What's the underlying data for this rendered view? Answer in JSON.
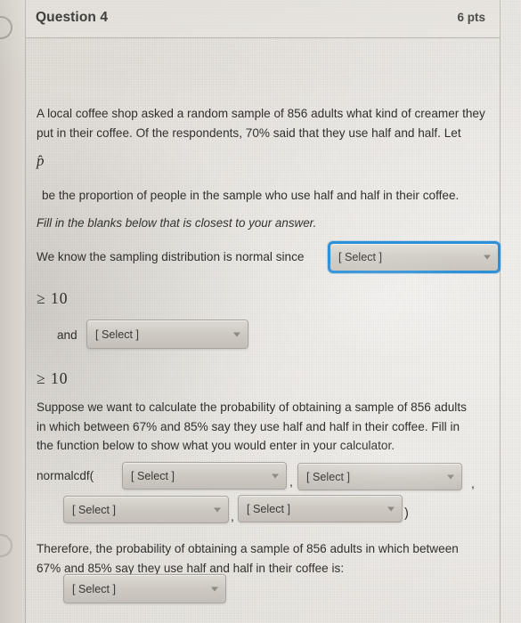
{
  "header": {
    "question_title": "Question 4",
    "points": "6 pts"
  },
  "body": {
    "paragraph_1": "A local coffee shop asked a random sample of 856 adults what kind of creamer they put in their coffee. Of the respondents, 70% said that they use half and half. Let",
    "phat_symbol": "p̂",
    "paragraph_2": "be the proportion of people in the sample who use half and half in their coffee.",
    "instruction_italic": "Fill in the blanks below that is closest to your answer.",
    "label_since": "We know the sampling distribution is normal since",
    "ge_ten_1": "≥ 10",
    "label_and": "and",
    "ge_ten_2": "≥ 10",
    "paragraph_3": "Suppose we want to calculate the probability of obtaining a sample of 856 adults in which between 67% and 85% say they use half and half in their coffee. Fill in the function below to show what you would enter in your calculator.",
    "label_normalcdf": "normalcdf(",
    "comma_1": ",",
    "comma_2": ",",
    "comma_3": ",",
    "paren_close": ")",
    "paragraph_4": "Therefore, the probability of obtaining a sample of 856 adults in which between 67% and 85% say they use half and half in their coffee is:"
  },
  "selects": {
    "condition": {
      "value": "[ Select ]",
      "focused": true
    },
    "and_condition": {
      "value": "[ Select ]",
      "focused": false
    },
    "normalcdf_arg_1": {
      "value": "[ Select ]",
      "focused": false
    },
    "normalcdf_arg_2": {
      "value": "[ Select ]",
      "focused": false
    },
    "normalcdf_arg_3": {
      "value": "[ Select ]",
      "focused": false
    },
    "normalcdf_arg_4": {
      "value": "[ Select ]",
      "focused": false
    },
    "final_answer": {
      "value": "[ Select ]",
      "focused": false
    }
  },
  "colors": {
    "focus_ring": "#2d8fd5",
    "card_background": "#e6e3dd",
    "text": "#32302d",
    "select_face": "#cecac3"
  }
}
